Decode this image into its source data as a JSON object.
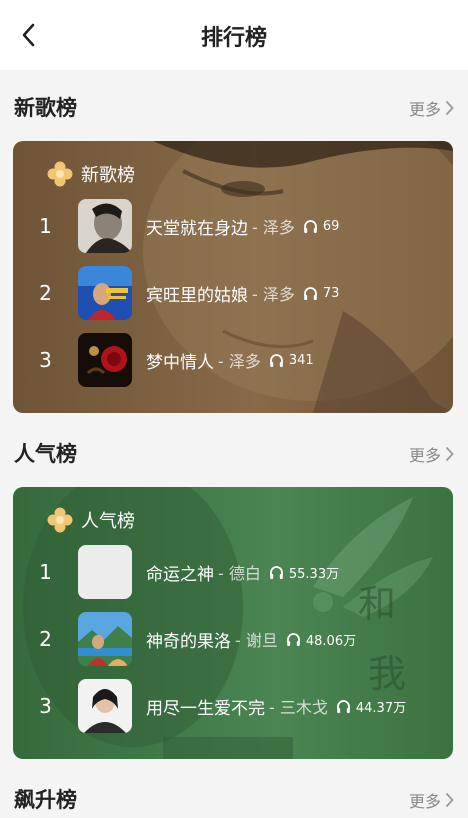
{
  "header": {
    "title": "排行榜"
  },
  "more_label": "更多",
  "sections": [
    {
      "title": "新歌榜",
      "card_label": "新歌榜",
      "songs": [
        {
          "rank": "1",
          "title": "天堂就在身边",
          "artist": "- 泽多",
          "plays": "69"
        },
        {
          "rank": "2",
          "title": "宾旺里的姑娘",
          "artist": "- 泽多",
          "plays": "73"
        },
        {
          "rank": "3",
          "title": "梦中情人",
          "artist": "- 泽多",
          "plays": "341"
        }
      ]
    },
    {
      "title": "人气榜",
      "card_label": "人气榜",
      "songs": [
        {
          "rank": "1",
          "title": "命运之神",
          "artist": "- 德白",
          "plays": "55.33万"
        },
        {
          "rank": "2",
          "title": "神奇的果洛",
          "artist": "- 谢旦",
          "plays": "48.06万"
        },
        {
          "rank": "3",
          "title": "用尽一生爱不完",
          "artist": "- 三木戈",
          "plays": "44.37万"
        }
      ]
    },
    {
      "title": "飙升榜"
    }
  ],
  "colors": {
    "new_card": "#7a5e3c",
    "popular_card": "#3f7346",
    "badge": "#f0c873"
  },
  "icons": [
    "back-arrow-icon",
    "chevron-right-icon",
    "flower-badge-icon",
    "headphones-icon"
  ]
}
